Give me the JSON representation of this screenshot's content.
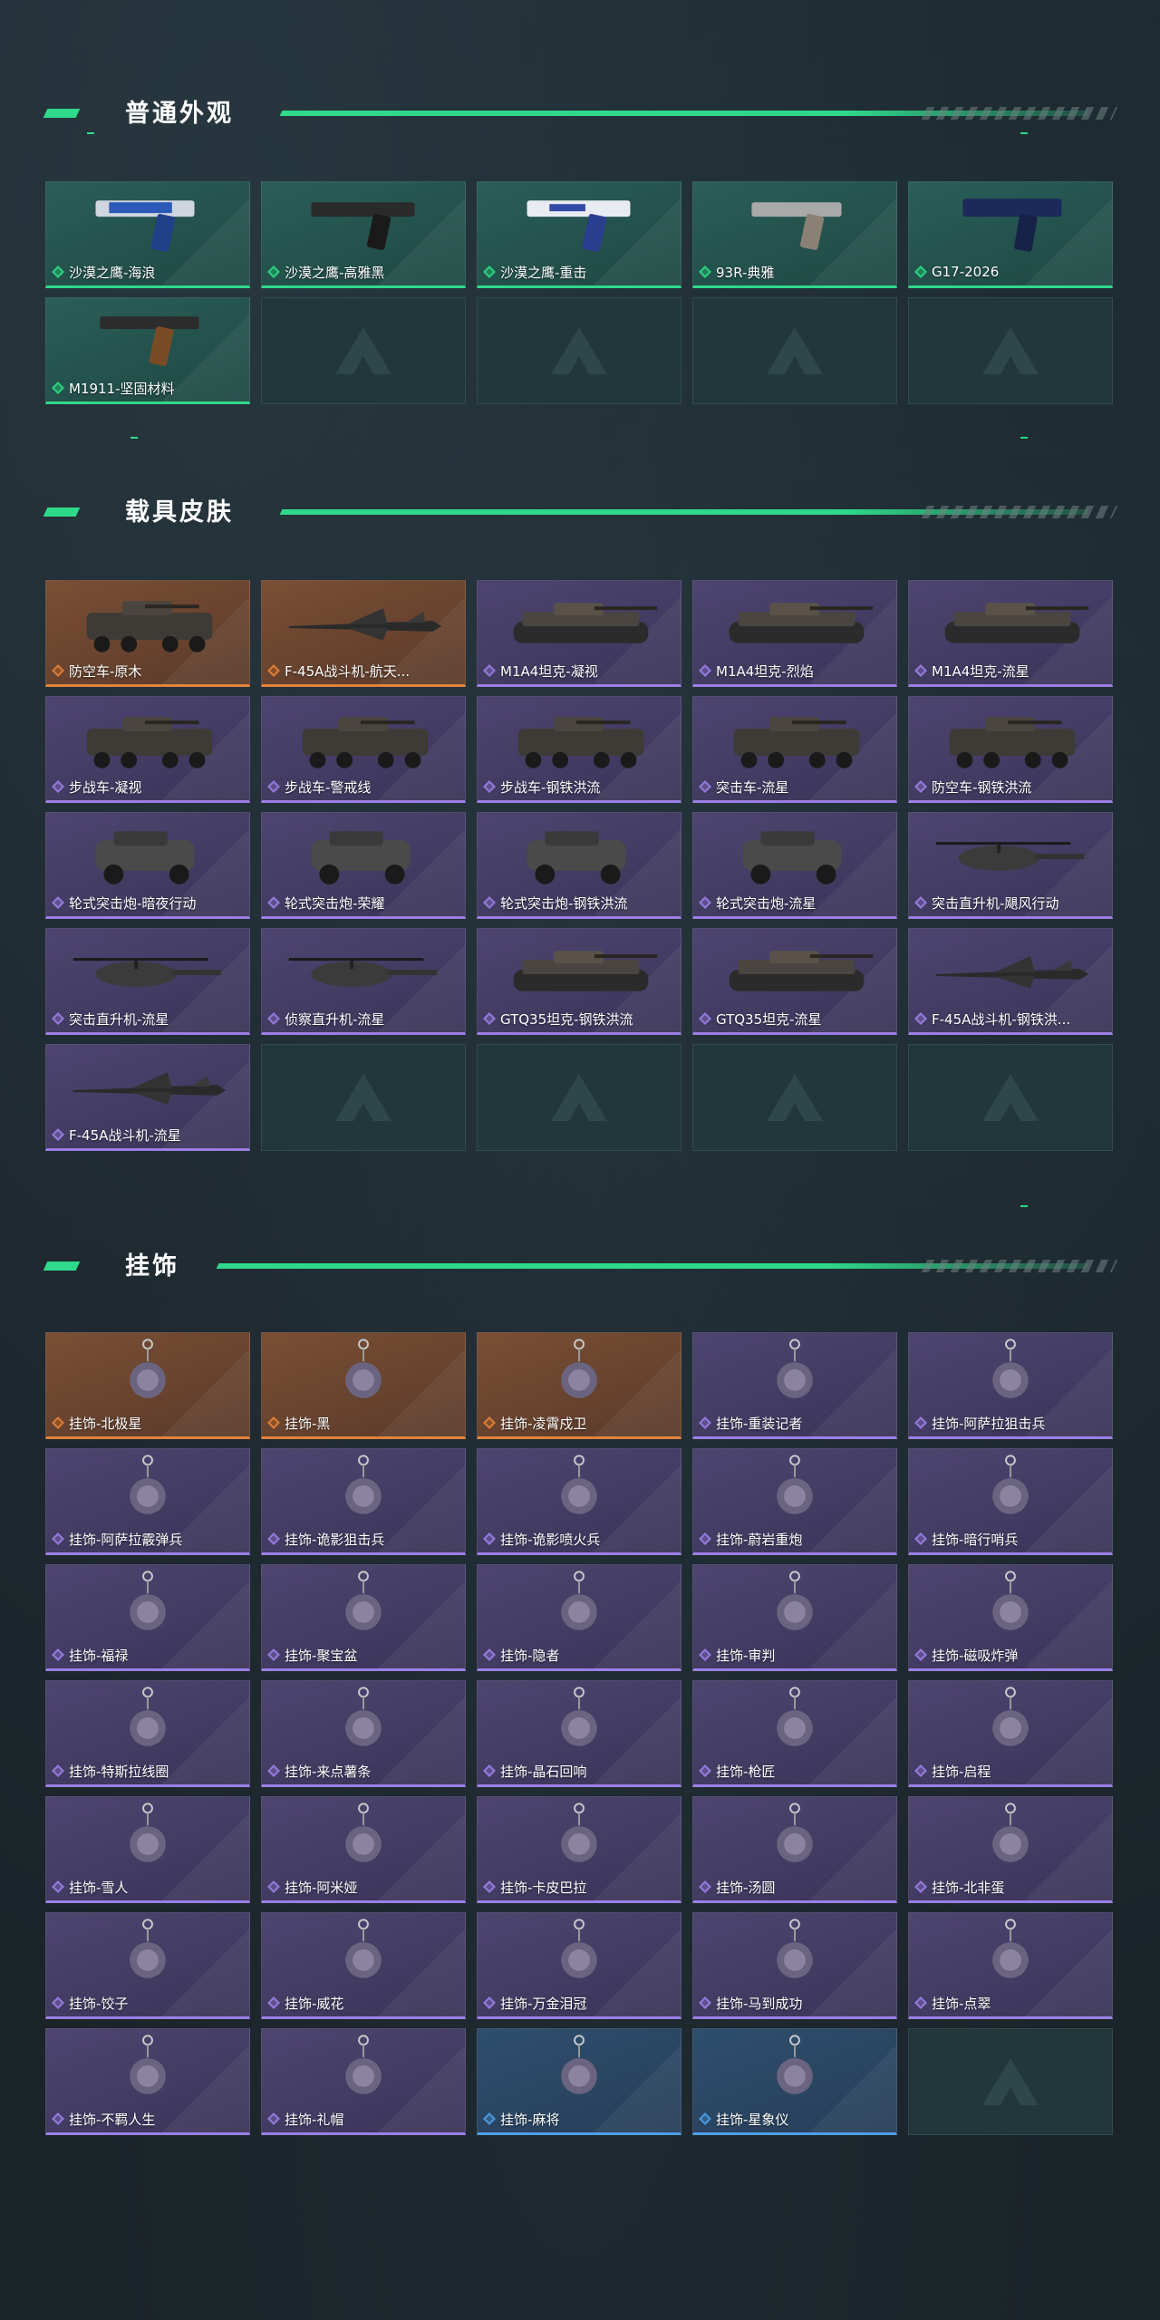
{
  "colors": {
    "accent": "#2fd98a",
    "rarity_green": "#2fd98a",
    "rarity_orange": "#e3823b",
    "rarity_purple": "#9b7fe6",
    "rarity_blue": "#4d9fe6"
  },
  "sections": [
    {
      "title": "普通外观",
      "items": [
        {
          "name": "沙漠之鹰-海浪",
          "rarity": "green",
          "art": "pistol-blue"
        },
        {
          "name": "沙漠之鹰-高雅黑",
          "rarity": "green",
          "art": "pistol-black"
        },
        {
          "name": "沙漠之鹰-重击",
          "rarity": "green",
          "art": "pistol-white"
        },
        {
          "name": "93R-典雅",
          "rarity": "green",
          "art": "pistol-silver"
        },
        {
          "name": "G17-2026",
          "rarity": "green",
          "art": "pistol-navy"
        },
        {
          "name": "M1911-坚固材料",
          "rarity": "green",
          "art": "pistol-wood"
        }
      ],
      "empty_slots": 4
    },
    {
      "title": "载具皮肤",
      "items": [
        {
          "name": "防空车-原木",
          "rarity": "orange",
          "art": "apc"
        },
        {
          "name": "F-45A战斗机-航天...",
          "rarity": "orange",
          "art": "jet"
        },
        {
          "name": "M1A4坦克-凝视",
          "rarity": "purple",
          "art": "tank"
        },
        {
          "name": "M1A4坦克-烈焰",
          "rarity": "purple",
          "art": "tank"
        },
        {
          "name": "M1A4坦克-流星",
          "rarity": "purple",
          "art": "tank"
        },
        {
          "name": "步战车-凝视",
          "rarity": "purple",
          "art": "apc"
        },
        {
          "name": "步战车-警戒线",
          "rarity": "purple",
          "art": "apc"
        },
        {
          "name": "步战车-钢铁洪流",
          "rarity": "purple",
          "art": "apc"
        },
        {
          "name": "突击车-流星",
          "rarity": "purple",
          "art": "apc"
        },
        {
          "name": "防空车-钢铁洪流",
          "rarity": "purple",
          "art": "apc"
        },
        {
          "name": "轮式突击炮-暗夜行动",
          "rarity": "purple",
          "art": "buggy"
        },
        {
          "name": "轮式突击炮-荣耀",
          "rarity": "purple",
          "art": "buggy"
        },
        {
          "name": "轮式突击炮-钢铁洪流",
          "rarity": "purple",
          "art": "buggy"
        },
        {
          "name": "轮式突击炮-流星",
          "rarity": "purple",
          "art": "buggy"
        },
        {
          "name": "突击直升机-飓风行动",
          "rarity": "purple",
          "art": "heli"
        },
        {
          "name": "突击直升机-流星",
          "rarity": "purple",
          "art": "heli"
        },
        {
          "name": "侦察直升机-流星",
          "rarity": "purple",
          "art": "heli"
        },
        {
          "name": "GTQ35坦克-钢铁洪流",
          "rarity": "purple",
          "art": "tank"
        },
        {
          "name": "GTQ35坦克-流星",
          "rarity": "purple",
          "art": "tank"
        },
        {
          "name": "F-45A战斗机-钢铁洪...",
          "rarity": "purple",
          "art": "jet"
        },
        {
          "name": "F-45A战斗机-流星",
          "rarity": "purple",
          "art": "jet"
        }
      ],
      "empty_slots": 4
    },
    {
      "title": "挂饰",
      "items": [
        {
          "name": "挂饰-北极星",
          "rarity": "orange",
          "art": "charm"
        },
        {
          "name": "挂饰-黑",
          "rarity": "orange",
          "art": "charm"
        },
        {
          "name": "挂饰-凌霄戍卫",
          "rarity": "orange",
          "art": "charm"
        },
        {
          "name": "挂饰-重装记者",
          "rarity": "purple",
          "art": "charm"
        },
        {
          "name": "挂饰-阿萨拉狙击兵",
          "rarity": "purple",
          "art": "charm"
        },
        {
          "name": "挂饰-阿萨拉霰弹兵",
          "rarity": "purple",
          "art": "charm"
        },
        {
          "name": "挂饰-诡影狙击兵",
          "rarity": "purple",
          "art": "charm"
        },
        {
          "name": "挂饰-诡影喷火兵",
          "rarity": "purple",
          "art": "charm"
        },
        {
          "name": "挂饰-蔚岩重炮",
          "rarity": "purple",
          "art": "charm"
        },
        {
          "name": "挂饰-暗行哨兵",
          "rarity": "purple",
          "art": "charm"
        },
        {
          "name": "挂饰-福禄",
          "rarity": "purple",
          "art": "charm"
        },
        {
          "name": "挂饰-聚宝盆",
          "rarity": "purple",
          "art": "charm"
        },
        {
          "name": "挂饰-隐者",
          "rarity": "purple",
          "art": "charm"
        },
        {
          "name": "挂饰-审判",
          "rarity": "purple",
          "art": "charm"
        },
        {
          "name": "挂饰-磁吸炸弹",
          "rarity": "purple",
          "art": "charm"
        },
        {
          "name": "挂饰-特斯拉线圈",
          "rarity": "purple",
          "art": "charm"
        },
        {
          "name": "挂饰-来点薯条",
          "rarity": "purple",
          "art": "charm"
        },
        {
          "name": "挂饰-晶石回响",
          "rarity": "purple",
          "art": "charm"
        },
        {
          "name": "挂饰-枪匠",
          "rarity": "purple",
          "art": "charm"
        },
        {
          "name": "挂饰-启程",
          "rarity": "purple",
          "art": "charm"
        },
        {
          "name": "挂饰-雪人",
          "rarity": "purple",
          "art": "charm"
        },
        {
          "name": "挂饰-阿米娅",
          "rarity": "purple",
          "art": "charm"
        },
        {
          "name": "挂饰-卡皮巴拉",
          "rarity": "purple",
          "art": "charm"
        },
        {
          "name": "挂饰-汤圆",
          "rarity": "purple",
          "art": "charm"
        },
        {
          "name": "挂饰-北非蛋",
          "rarity": "purple",
          "art": "charm"
        },
        {
          "name": "挂饰-饺子",
          "rarity": "purple",
          "art": "charm"
        },
        {
          "name": "挂饰-威花",
          "rarity": "purple",
          "art": "charm"
        },
        {
          "name": "挂饰-万金泪冠",
          "rarity": "purple",
          "art": "charm"
        },
        {
          "name": "挂饰-马到成功",
          "rarity": "purple",
          "art": "charm"
        },
        {
          "name": "挂饰-点翠",
          "rarity": "purple",
          "art": "charm"
        },
        {
          "name": "挂饰-不羁人生",
          "rarity": "purple",
          "art": "charm"
        },
        {
          "name": "挂饰-礼帽",
          "rarity": "purple",
          "art": "charm"
        },
        {
          "name": "挂饰-麻将",
          "rarity": "blue",
          "art": "charm"
        },
        {
          "name": "挂饰-星象仪",
          "rarity": "blue",
          "art": "charm"
        }
      ],
      "empty_slots": 1
    }
  ]
}
